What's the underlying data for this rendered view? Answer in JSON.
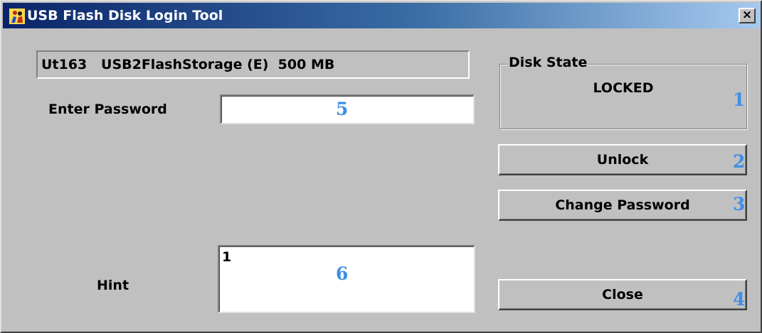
{
  "window": {
    "title": "USB Flash Disk Login Tool",
    "close_glyph": "×",
    "icon": "app-figure-icon"
  },
  "device": {
    "info": "Ut163   USB2FlashStorage (E)  500 MB"
  },
  "password": {
    "label": "Enter Password",
    "value": ""
  },
  "hint": {
    "label": "Hint",
    "value": "1"
  },
  "disk_state": {
    "legend": "Disk State",
    "state": "LOCKED"
  },
  "buttons": {
    "unlock": "Unlock",
    "change_password": "Change Password",
    "close": "Close"
  },
  "callouts": {
    "disk_state": "1",
    "unlock": "2",
    "change_password": "3",
    "close": "4",
    "password": "5",
    "hint": "6"
  },
  "colors": {
    "window_bg": "#c0c0c0",
    "title_start": "#0a246a",
    "title_end": "#a6caf0",
    "callout": "#3d8ee8"
  }
}
